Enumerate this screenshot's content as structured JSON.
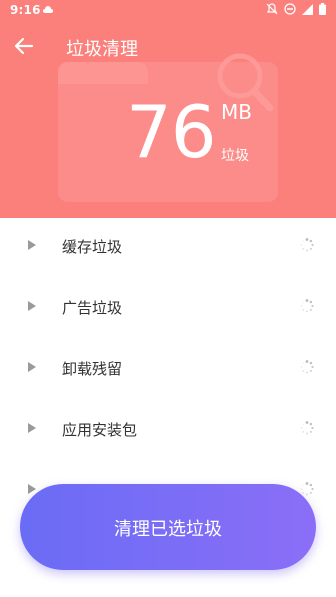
{
  "status_bar": {
    "time": "9:16",
    "icons": [
      "cloud-icon",
      "notifications-off-icon",
      "do-not-disturb-icon",
      "signal-icon",
      "battery-icon"
    ]
  },
  "app_bar": {
    "title": "垃圾清理",
    "back_icon": "arrow-back-icon"
  },
  "summary": {
    "size_value": "76",
    "size_unit": "MB",
    "size_caption": "垃圾"
  },
  "categories": [
    {
      "label": "缓存垃圾",
      "status": "scanning"
    },
    {
      "label": "广告垃圾",
      "status": "scanning"
    },
    {
      "label": "卸载残留",
      "status": "scanning"
    },
    {
      "label": "应用安装包",
      "status": "scanning"
    },
    {
      "label": "",
      "status": "scanning"
    }
  ],
  "actions": {
    "clean_label": "清理已选垃圾"
  },
  "colors": {
    "header": "#fb7f7b",
    "button_start": "#6a6cf5",
    "button_end": "#8b6ef7",
    "text_primary": "#333333",
    "arrow": "#9a9a9a"
  }
}
